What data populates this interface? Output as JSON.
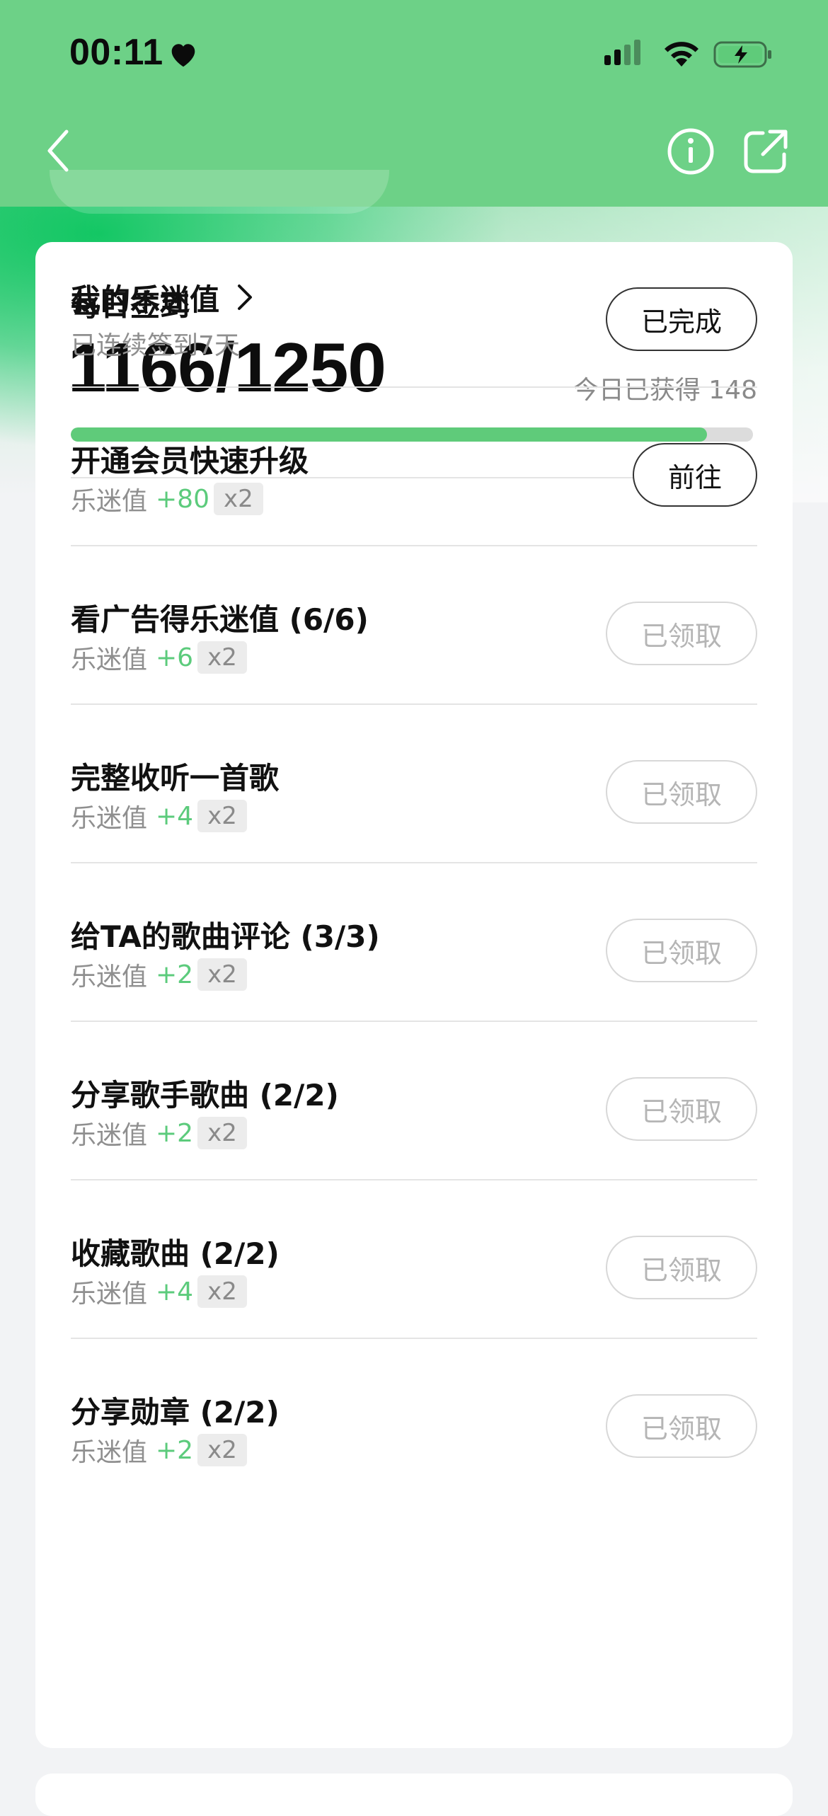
{
  "status_bar": {
    "time": "00:11",
    "heart_icon": "heart-icon",
    "signal_icon": "cellular-signal-icon",
    "wifi_icon": "wifi-icon",
    "battery_icon": "battery-charging-icon"
  },
  "nav": {
    "back_icon": "chevron-left-icon",
    "info_icon": "info-circle-icon",
    "share_icon": "share-external-icon"
  },
  "colors": {
    "header_green": "#6dd187",
    "accent_green": "#5fcb7a",
    "points_green": "#5ccb7c",
    "claimed_gray": "#b5b5b5"
  },
  "fan_value": {
    "title": "我的乐迷值",
    "current": "1166/1250",
    "progress": 0.933,
    "today_earned": "今日已获得 148"
  },
  "tasks": [
    {
      "title": "每日签到",
      "subtitle": "已连续签到7天",
      "points": "",
      "multiplier": "",
      "button": "已完成",
      "state": "done"
    },
    {
      "title": "开通会员快速升级",
      "subtitle": "乐迷值",
      "points": "+80",
      "multiplier": "x2",
      "button": "前往",
      "state": "go"
    },
    {
      "title": "看广告得乐迷值 (6/6)",
      "subtitle": "乐迷值",
      "points": "+6",
      "multiplier": "x2",
      "button": "已领取",
      "state": "claimed"
    },
    {
      "title": "完整收听一首歌",
      "subtitle": "乐迷值",
      "points": "+4",
      "multiplier": "x2",
      "button": "已领取",
      "state": "claimed"
    },
    {
      "title": "给TA的歌曲评论 (3/3)",
      "subtitle": "乐迷值",
      "points": "+2",
      "multiplier": "x2",
      "button": "已领取",
      "state": "claimed"
    },
    {
      "title": "分享歌手歌曲 (2/2)",
      "subtitle": "乐迷值",
      "points": "+2",
      "multiplier": "x2",
      "button": "已领取",
      "state": "claimed"
    },
    {
      "title": "收藏歌曲 (2/2)",
      "subtitle": "乐迷值",
      "points": "+4",
      "multiplier": "x2",
      "button": "已领取",
      "state": "claimed"
    },
    {
      "title": "分享勋章 (2/2)",
      "subtitle": "乐迷值",
      "points": "+2",
      "multiplier": "x2",
      "button": "已领取",
      "state": "claimed"
    }
  ]
}
